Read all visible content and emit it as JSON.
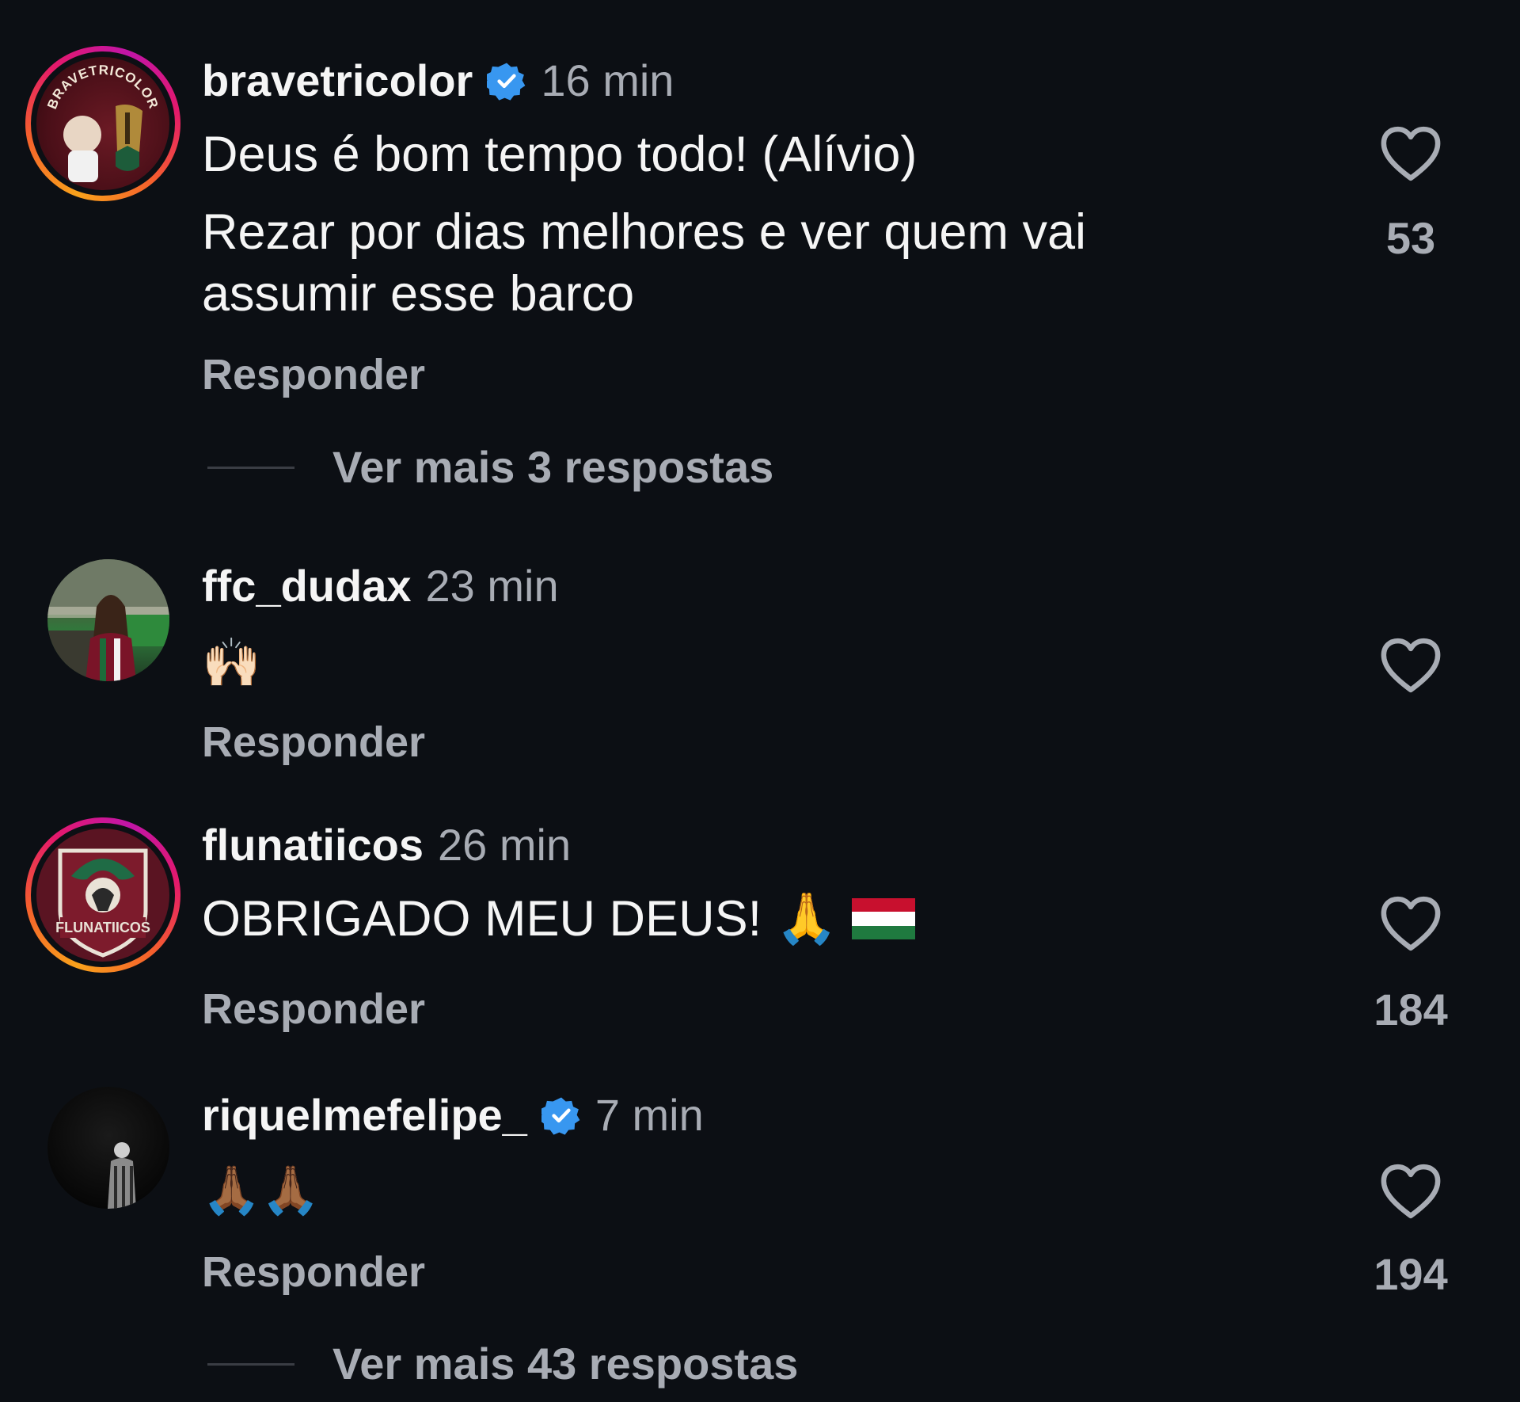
{
  "comments": [
    {
      "username": "bravetricolor",
      "verified": true,
      "time": "16 min",
      "lines": [
        "Deus é bom tempo todo! (Alívio)",
        "Rezar por dias melhores e ver quem vai",
        "assumir esse barco"
      ],
      "reply_label": "Responder",
      "likes": "53",
      "more_replies": "Ver mais 3 respostas",
      "avatar_text": "BRAVETRICOLOR"
    },
    {
      "username": "ffc_dudax",
      "verified": false,
      "time": "23 min",
      "text": "🙌🏻",
      "reply_label": "Responder",
      "likes": ""
    },
    {
      "username": "flunatiicos",
      "verified": false,
      "time": "26 min",
      "text": "OBRIGADO MEU DEUS! 🙏",
      "reply_label": "Responder",
      "likes": "184",
      "avatar_text": "FLUNATIICOS"
    },
    {
      "username": "riquelmefelipe_",
      "verified": true,
      "time": "7 min",
      "text": "🙏🏾🙏🏾",
      "reply_label": "Responder",
      "likes": "194",
      "more_replies": "Ver mais 43 respostas"
    }
  ],
  "icons": {
    "like": "heart-outline-icon",
    "verified": "verified-badge-icon"
  },
  "colors": {
    "background": "#0c0f14",
    "verified_blue": "#3897f0",
    "muted_text": "#a8acb4"
  }
}
